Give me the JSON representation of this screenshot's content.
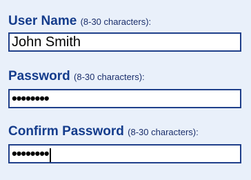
{
  "form": {
    "username": {
      "label": "User Name",
      "hint": "(8-30 characters):",
      "value": "John Smith"
    },
    "password": {
      "label": "Password",
      "hint": "(8-30 characters):",
      "value": "••••••••"
    },
    "confirm": {
      "label": "Confirm Password",
      "hint": "(8-30 characters):",
      "value": "••••••••"
    }
  },
  "colors": {
    "label": "#143c8c",
    "border": "#1f3f8a",
    "panel_background": "#e9f0fa"
  }
}
